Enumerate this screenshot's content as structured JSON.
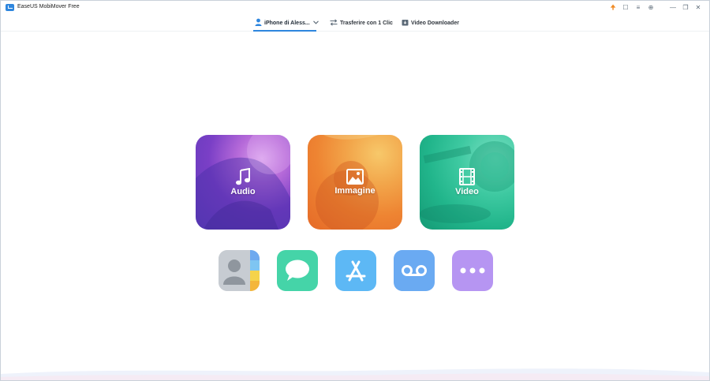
{
  "app": {
    "title": "EaseUS MobiMover Free"
  },
  "titlebar_icons": [
    "upgrade-arrow-icon",
    "feedback-icon",
    "menu-icon",
    "language-globe-icon",
    "minimize-icon",
    "restore-icon",
    "close-icon"
  ],
  "titlebar_glyphs": {
    "upgrade": "🠉",
    "feedback": "☐",
    "menu": "≡",
    "globe": "⊕",
    "minimize": "—",
    "restore": "❐",
    "close": "✕"
  },
  "nav": {
    "device_label": "iPhone di Aless...",
    "transfer_label": "Trasferire con 1 Clic",
    "video_label": "Video Downloader"
  },
  "tiles": {
    "audio_label": "Audio",
    "image_label": "Immagine",
    "video_label": "Video"
  },
  "small_tiles": [
    "contacts-icon",
    "messages-icon",
    "app-store-icon",
    "voicemail-icon",
    "more-icon"
  ],
  "colors": {
    "accent": "#2e86de",
    "audio": "#7a3fc6",
    "image": "#ee8432",
    "video": "#21b58b",
    "messages": "#45d4a8",
    "apps": "#5db8f5",
    "voicemail": "#6aaaf2",
    "more": "#b695f2"
  }
}
